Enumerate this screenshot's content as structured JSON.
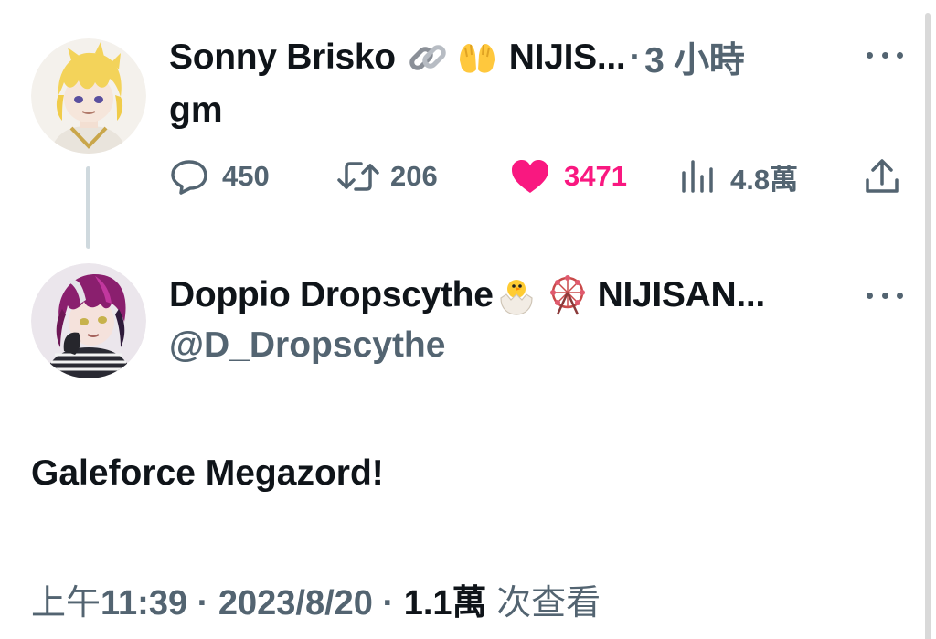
{
  "reply_parent": {
    "display_name": "Sonny Brisko",
    "emojis": [
      "link-emoji",
      "raising-hands-emoji"
    ],
    "affiliation_truncated": "NIJIS...",
    "separator": "·",
    "timestamp": "3 小時",
    "text": "gm",
    "actions": {
      "replies": "450",
      "retweets": "206",
      "likes": "3471",
      "views": "4.8萬"
    },
    "like_color": "#f91880"
  },
  "main_tweet": {
    "display_name": "Doppio Dropscythe",
    "emojis": [
      "hatching-chick-emoji",
      "ferris-wheel-emoji"
    ],
    "affiliation_truncated": "NIJISAN...",
    "handle": "@D_Dropscythe",
    "text": "Galeforce Megazord!",
    "meta": {
      "period": "上午",
      "time": "11:39",
      "date": "2023/8/20",
      "views": "1.1萬",
      "views_suffix": "次查看",
      "separator": "·"
    }
  },
  "colors": {
    "text_primary": "#0f1419",
    "text_secondary": "#536471",
    "thread_line": "#cfd9de"
  }
}
